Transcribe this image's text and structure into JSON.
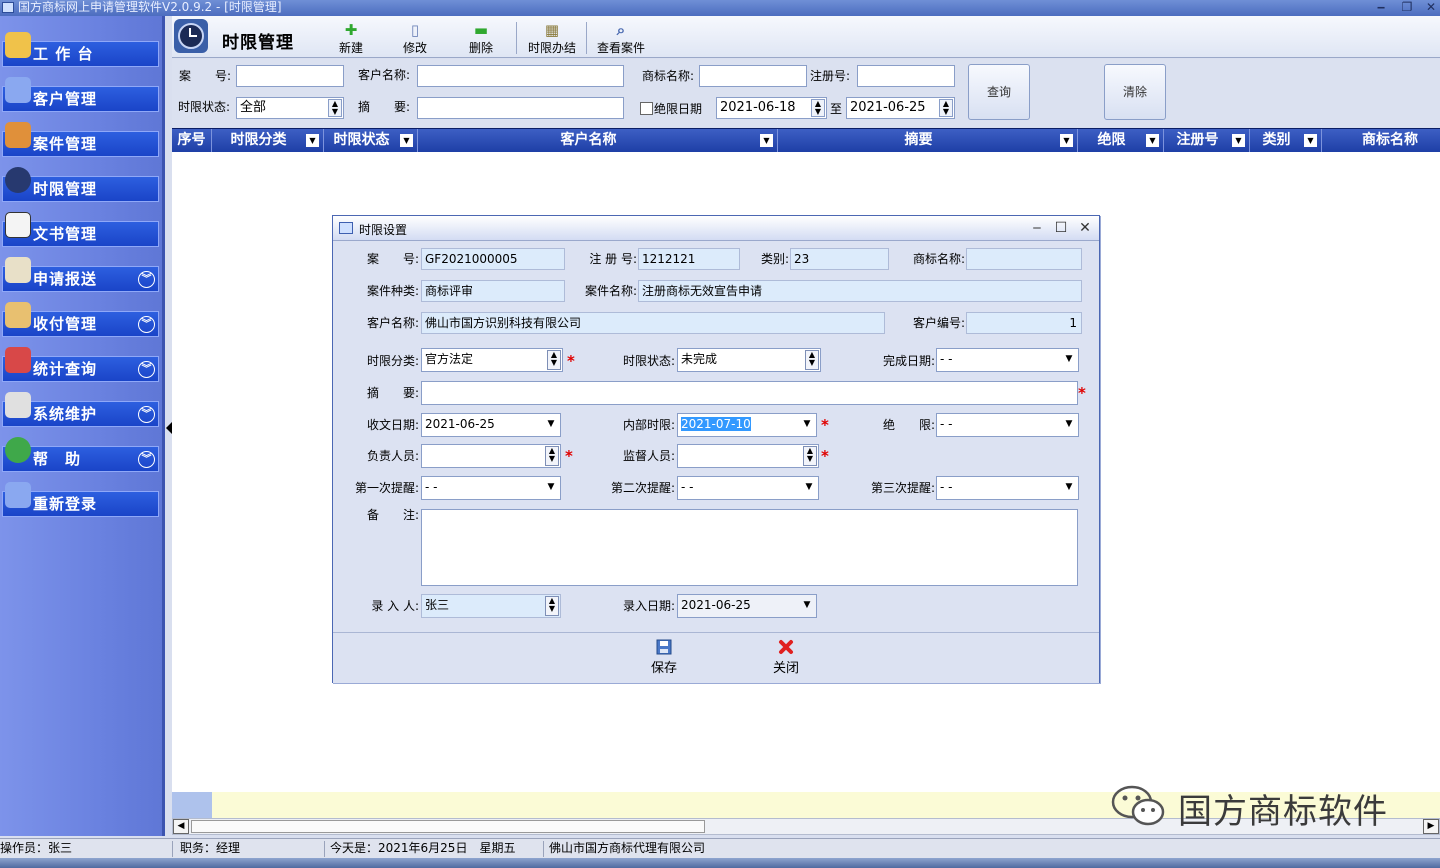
{
  "window": {
    "title": "国方商标网上申请管理软件V2.0.9.2 - [时限管理]",
    "minimize": "‒",
    "restore": "❐",
    "close": "✕"
  },
  "sidebar": {
    "items": [
      {
        "label": "工 作 台",
        "has_chevron": false,
        "icon_color": "#f0c24a"
      },
      {
        "label": "客户管理",
        "has_chevron": false,
        "icon_color": "#8aa8f0"
      },
      {
        "label": "案件管理",
        "has_chevron": false,
        "icon_color": "#e0903a"
      },
      {
        "label": "时限管理",
        "has_chevron": false,
        "icon_color": "#27396f"
      },
      {
        "label": "文书管理",
        "has_chevron": false,
        "icon_color": "#f4f4f4"
      },
      {
        "label": "申请报送",
        "has_chevron": true,
        "icon_color": "#e8e0c8"
      },
      {
        "label": "收付管理",
        "has_chevron": true,
        "icon_color": "#e8c070"
      },
      {
        "label": "统计查询",
        "has_chevron": true,
        "icon_color": "#d84848"
      },
      {
        "label": "系统维护",
        "has_chevron": true,
        "icon_color": "#e0e0e0"
      },
      {
        "label": "帮　助",
        "has_chevron": true,
        "icon_color": "#3fa84a"
      },
      {
        "label": "重新登录",
        "has_chevron": false,
        "icon_color": "#8aa8f0"
      }
    ],
    "chevron": "︾"
  },
  "toolbar": {
    "module_title": "时限管理",
    "buttons": [
      {
        "label": "新建",
        "glyph": "✚",
        "color": "#2fa82f"
      },
      {
        "label": "修改",
        "glyph": "▯",
        "color": "#6e84b8"
      },
      {
        "label": "删除",
        "glyph": "▬",
        "color": "#2fa82f"
      },
      {
        "label": "时限办结",
        "glyph": "▦",
        "color": "#8a7a3a"
      },
      {
        "label": "查看案件",
        "glyph": "⌕",
        "color": "#4a6ab0"
      }
    ]
  },
  "search": {
    "case_no_label": "案　　号:",
    "case_no_value": "",
    "client_label": "客户名称:",
    "client_value": "",
    "brand_label": "商标名称:",
    "brand_value": "",
    "reg_label": "注册号:",
    "reg_value": "",
    "status_label": "时限状态:",
    "status_value": "全部",
    "summary_label": "摘　　要:",
    "summary_value": "",
    "deadline_label": "绝限日期",
    "deadline_checked": false,
    "date_from": "2021-06-18",
    "to_label": "至",
    "date_to": "2021-06-25",
    "query_button": "查询",
    "clear_button": "清除"
  },
  "grid": {
    "columns": [
      "序号",
      "时限分类",
      "时限状态",
      "客户名称",
      "摘要",
      "绝限",
      "注册号",
      "类别",
      "商标名称"
    ],
    "dropdown_glyph": "▼"
  },
  "hscroll": {
    "left": "◀",
    "right": "▶"
  },
  "dialog": {
    "title": "时限设置",
    "case_no_label": "案　　号:",
    "case_no": "GF2021000005",
    "reg_label": "注 册 号:",
    "reg_no": "1212121",
    "class_label": "类别:",
    "class": "23",
    "brand_label": "商标名称:",
    "brand": "",
    "case_type_label": "案件种类:",
    "case_type": "商标评审",
    "case_name_label": "案件名称:",
    "case_name": "注册商标无效宣告申请",
    "client_label": "客户名称:",
    "client": "佛山市国方识别科技有限公司",
    "client_no_label": "客户编号:",
    "client_no": "1",
    "category_label": "时限分类:",
    "category": "官方法定",
    "status_label": "时限状态:",
    "status": "未完成",
    "finish_label": "完成日期:",
    "finish": "  -  -",
    "summary_label": "摘　　要:",
    "summary": "",
    "received_label": "收文日期:",
    "received": "2021-06-25",
    "internal_label": "内部时限:",
    "internal": "2021-07-10",
    "deadline_label": "绝　　限:",
    "deadline": "  -  -",
    "owner_label": "负责人员:",
    "owner": "",
    "supervisor_label": "监督人员:",
    "supervisor": "",
    "remind1_label": "第一次提醒:",
    "remind1": "  -  -",
    "remind2_label": "第二次提醒:",
    "remind2": "  -  -",
    "remind3_label": "第三次提醒:",
    "remind3": "  -  -",
    "note_label": "备　　注:",
    "note": "",
    "entered_by_label": "录 入 人:",
    "entered_by": "张三",
    "entry_date_label": "录入日期:",
    "entry_date": "2021-06-25",
    "save_button": "保存",
    "close_button": "关闭",
    "required_mark": "*"
  },
  "status_bar": {
    "operator": "操作员：张三",
    "role": "职务：经理",
    "today": "今天是：2021年6月25日　星期五",
    "company": "佛山市国方商标代理有限公司"
  },
  "watermark": {
    "text": "国方商标软件"
  }
}
